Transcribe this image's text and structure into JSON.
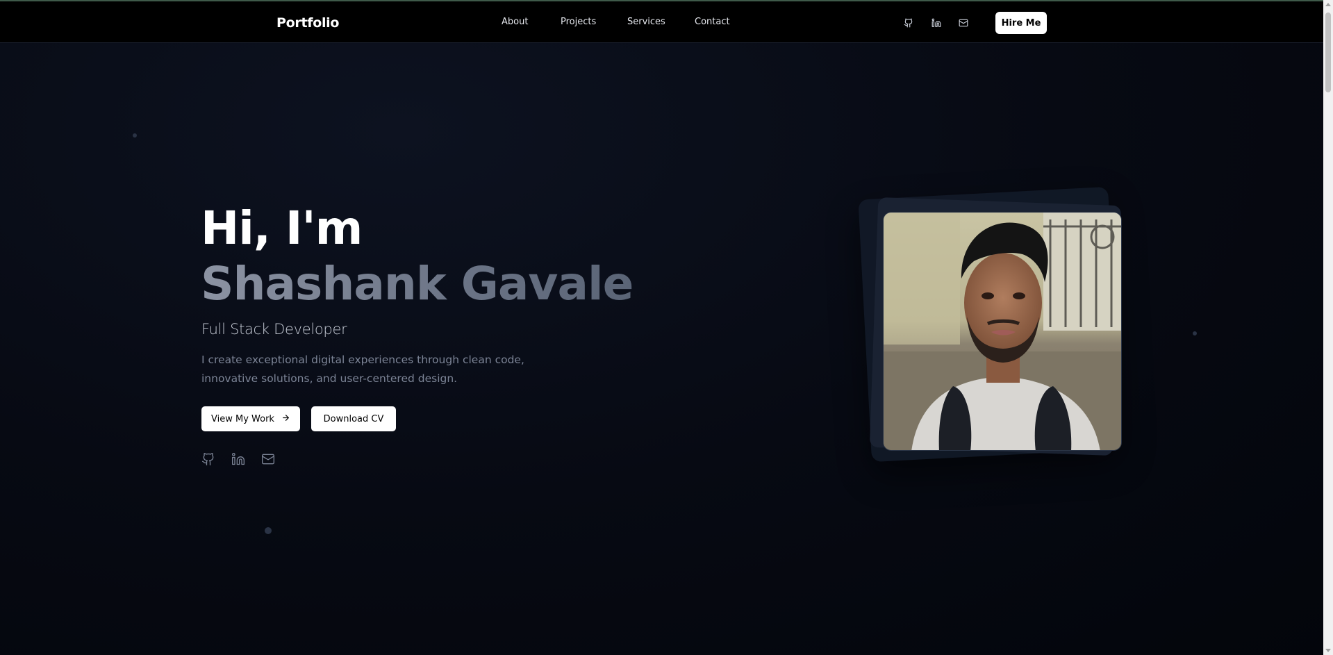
{
  "nav": {
    "brand": "Portfolio",
    "links": [
      "About",
      "Projects",
      "Services",
      "Contact"
    ],
    "icons": [
      "github-icon",
      "linkedin-icon",
      "mail-icon"
    ],
    "hire_label": "Hire Me"
  },
  "hero": {
    "greeting": "Hi, I'm",
    "name": "Shashank Gavale",
    "role": "Full Stack Developer",
    "description": "I create exceptional digital experiences through clean code, innovative solutions, and user-centered design.",
    "primary_button": "View My Work",
    "secondary_button": "Download CV",
    "social_icons": [
      "github-icon",
      "linkedin-icon",
      "mail-icon"
    ]
  },
  "colors": {
    "background": "#05080f",
    "navbar": "#000000",
    "accent_button": "#ffffff",
    "name_gradient": "#7a8294"
  }
}
